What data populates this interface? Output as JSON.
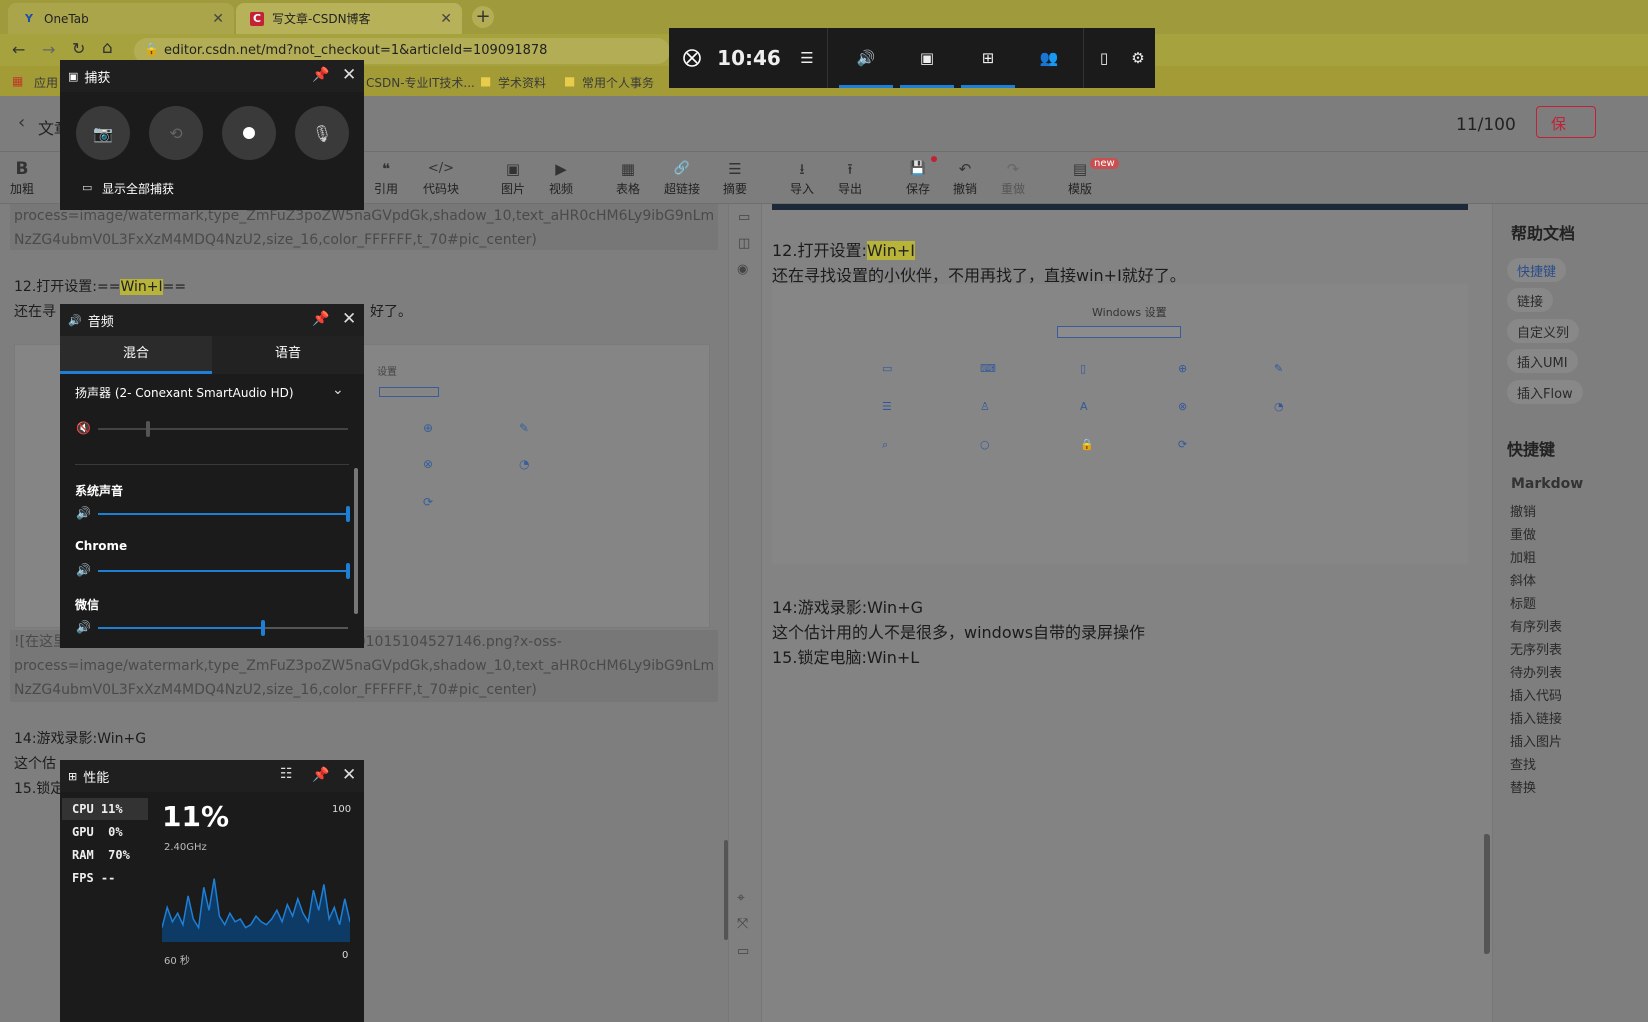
{
  "browser": {
    "tabs": [
      {
        "title": "OneTab",
        "icon": "Y"
      },
      {
        "title": "写文章-CSDN博客",
        "icon": "C"
      }
    ],
    "url": "editor.csdn.net/md?not_checkout=1&articleId=109091878",
    "bookmarks": [
      "应用",
      "CSDN-专业IT技术...",
      "学术资料",
      "常用个人事务"
    ]
  },
  "editor": {
    "back_label": "文章",
    "word_count": "11/100",
    "save_label": "保",
    "toolbar": [
      {
        "icon": "B",
        "label": "加粗"
      },
      {
        "icon": "❝",
        "label": "引用"
      },
      {
        "icon": "</>",
        "label": "代码块"
      },
      {
        "icon": "▣",
        "label": "图片"
      },
      {
        "icon": "▶",
        "label": "视频"
      },
      {
        "icon": "▦",
        "label": "表格"
      },
      {
        "icon": "🔗",
        "label": "超链接"
      },
      {
        "icon": "☰",
        "label": "摘要"
      },
      {
        "icon": "⭳",
        "label": "导入"
      },
      {
        "icon": "⭱",
        "label": "导出"
      },
      {
        "icon": "💾",
        "label": "保存"
      },
      {
        "icon": "↶",
        "label": "撤销"
      },
      {
        "icon": "↷",
        "label": "重做"
      },
      {
        "icon": "▤",
        "label": "模版"
      }
    ],
    "new_badge": "new",
    "left": {
      "code1a": "process=image/watermark,type_ZmFuZ3poZW5naGVpdGk,shadow_10,text_aHR0cHM6Ly9ibG9nLm",
      "code1b": "NzZG4ubmV0L3FxXzM4MDQ4NzU2,size_16,color_FFFFFF,t_70#pic_center)",
      "h12_prefix": "12.打开设置:==",
      "h12_key": "Win+I",
      "h12_suffix": "==",
      "p12": "还在寻",
      "p12b": "好了。",
      "code2a": "![在这里",
      "code2a2": "20201015104527146.png?x-oss-",
      "code2b": "process=image/watermark,type_ZmFuZ3poZW5naGVpdGk,shadow_10,text_aHR0cHM6Ly9ibG9nLm",
      "code2c": "NzZG4ubmV0L3FxXzM4MDQ4NzU2,size_16,color_FFFFFF,t_70#pic_center)",
      "h14": "14:游戏录影:Win+G",
      "p14": "这个估",
      "h15": "15.锁定"
    },
    "right": {
      "h12_prefix": "12.打开设置:",
      "h12_key": "Win+I",
      "p12": "还在寻找设置的小伙伴，不用再找了，直接win+I就好了。",
      "win_title": "Windows 设置",
      "h14": "14:游戏录影:Win+G",
      "p14": "这个估计用的人不是很多，windows自带的录屏操作",
      "h15": "15.锁定电脑:Win+L"
    },
    "help": {
      "title": "帮助文档",
      "tags": [
        "快捷键",
        "链接",
        "自定义列",
        "插入UMI",
        "插入Flow"
      ],
      "shortcut_title": "快捷键",
      "markdown_label": "Markdow",
      "items": [
        "撤销",
        "重做",
        "加粗",
        "斜体",
        "标题",
        "有序列表",
        "无序列表",
        "待办列表",
        "插入代码",
        "插入链接",
        "插入图片",
        "查找",
        "替换"
      ]
    }
  },
  "xbox_bar": {
    "time": "10:46"
  },
  "capture": {
    "title": "捕获",
    "show_all": "显示全部捕获"
  },
  "audio": {
    "title": "音频",
    "tab_mix": "混合",
    "tab_voice": "语音",
    "device": "扬声器 (2- Conexant SmartAudio HD)",
    "master_level": 0.2,
    "apps": [
      {
        "name": "系统声音",
        "level": 1.0
      },
      {
        "name": "Chrome",
        "level": 1.0
      },
      {
        "name": "微信",
        "level": 0.66
      }
    ]
  },
  "performance": {
    "title": "性能",
    "rows": [
      {
        "label": "CPU",
        "value": "11%"
      },
      {
        "label": "GPU",
        "value": "0%"
      },
      {
        "label": "RAM",
        "value": "70%"
      },
      {
        "label": "FPS",
        "value": "--"
      }
    ],
    "big_value": "11%",
    "freq": "2.40GHz",
    "max_label": "100",
    "time_label": "60 秒",
    "min_label": "0",
    "history": [
      10,
      24,
      14,
      20,
      12,
      32,
      16,
      10,
      38,
      22,
      44,
      18,
      12,
      20,
      14,
      16,
      10,
      12,
      18,
      14,
      12,
      16,
      22,
      14,
      26,
      18,
      30,
      20,
      14,
      36,
      22,
      40,
      16,
      24,
      12,
      30,
      14
    ]
  },
  "colors": {
    "accent": "#1e7fd6",
    "highlight": "#b8b43a",
    "csdn_red": "#c32136"
  }
}
